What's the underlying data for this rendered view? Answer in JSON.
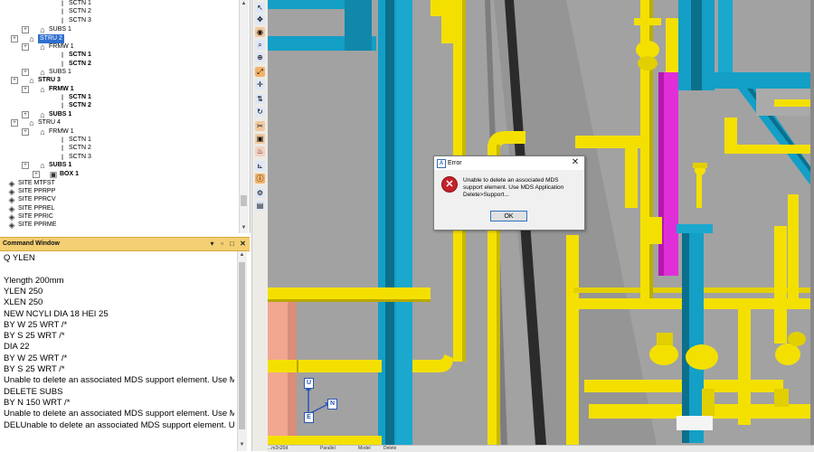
{
  "tree": {
    "rows": [
      {
        "label": "SCTN 1",
        "bold": false,
        "selected": false,
        "icon": "section-icon"
      },
      {
        "label": "SCTN 2",
        "bold": false,
        "selected": false,
        "icon": "section-icon"
      },
      {
        "label": "SCTN 3",
        "bold": false,
        "selected": false,
        "icon": "section-icon"
      },
      {
        "label": "SUBS 1",
        "bold": false,
        "selected": false,
        "icon": "subframe-icon"
      },
      {
        "label": "STRU 2",
        "bold": false,
        "selected": true,
        "icon": "structure-icon"
      },
      {
        "label": "FRMW 1",
        "bold": false,
        "selected": false,
        "icon": "framework-icon"
      },
      {
        "label": "SCTN 1",
        "bold": true,
        "selected": false,
        "icon": "section-icon"
      },
      {
        "label": "SCTN 2",
        "bold": true,
        "selected": false,
        "icon": "section-icon"
      },
      {
        "label": "SUBS 1",
        "bold": false,
        "selected": false,
        "icon": "subframe-icon"
      },
      {
        "label": "STRU 3",
        "bold": true,
        "selected": false,
        "icon": "structure-icon"
      },
      {
        "label": "FRMW 1",
        "bold": true,
        "selected": false,
        "icon": "framework-icon"
      },
      {
        "label": "SCTN 1",
        "bold": true,
        "selected": false,
        "icon": "section-icon"
      },
      {
        "label": "SCTN 2",
        "bold": true,
        "selected": false,
        "icon": "section-icon"
      },
      {
        "label": "SUBS 1",
        "bold": true,
        "selected": false,
        "icon": "subframe-icon"
      },
      {
        "label": "STRU 4",
        "bold": false,
        "selected": false,
        "icon": "structure-icon"
      },
      {
        "label": "FRMW 1",
        "bold": false,
        "selected": false,
        "icon": "framework-icon"
      },
      {
        "label": "SCTN 1",
        "bold": false,
        "selected": false,
        "icon": "section-icon"
      },
      {
        "label": "SCTN 2",
        "bold": false,
        "selected": false,
        "icon": "section-icon"
      },
      {
        "label": "SCTN 3",
        "bold": false,
        "selected": false,
        "icon": "section-icon"
      },
      {
        "label": "SUBS 1",
        "bold": true,
        "selected": false,
        "icon": "subframe-icon"
      },
      {
        "label": "BOX 1",
        "bold": true,
        "selected": false,
        "icon": "box-icon"
      },
      {
        "label": "SITE MTFST",
        "bold": false,
        "selected": false,
        "icon": "site-icon"
      },
      {
        "label": "SITE PPRPP",
        "bold": false,
        "selected": false,
        "icon": "site-icon"
      },
      {
        "label": "SITE PPRCV",
        "bold": false,
        "selected": false,
        "icon": "site-icon"
      },
      {
        "label": "SITE PPREL",
        "bold": false,
        "selected": false,
        "icon": "site-icon"
      },
      {
        "label": "SITE PPRIC",
        "bold": false,
        "selected": false,
        "icon": "site-icon"
      },
      {
        "label": "SITE PPRME",
        "bold": false,
        "selected": false,
        "icon": "site-icon"
      }
    ]
  },
  "command_window": {
    "title": "Command Window",
    "lines": [
      "Q YLEN",
      "",
      "Ylength 200mm",
      "YLEN 250",
      "XLEN 250",
      "NEW NCYLI DIA 18 HEI 25",
      "BY W 25 WRT /*",
      "BY S 25 WRT /*",
      "DIA 22",
      "BY W 25 WRT /*",
      "BY S 25 WRT /*",
      "Unable to delete an associated MDS support element. Use MI",
      "DELETE SUBS",
      "BY N 150 WRT /*",
      "Unable to delete an associated MDS support element. Use MI",
      "DELUnable to delete an associated MDS support element. Us"
    ]
  },
  "toolbar": {
    "icons": [
      "select-icon",
      "pan-icon",
      "orbit-icon",
      "zoom-window-icon",
      "zoom-icon",
      "walk-icon",
      "move-icon",
      "scale-icon",
      "rotate-icon",
      "clip-icon",
      "capture-icon",
      "fire-icon",
      "measure-icon",
      "info-icon",
      "settings-icon",
      "view-icon"
    ]
  },
  "dialog": {
    "title": "Error",
    "message": "Unable to delete an associated MDS support element. Use MDS Application Delete>Support...",
    "ok_label": "OK",
    "close_glyph": "✕"
  },
  "axes": {
    "up": "U",
    "north": "N",
    "east": "E"
  },
  "viewport_tabs": [
    "Parallel",
    "Model",
    "Delete"
  ],
  "viewport_tab_prefix": "...m2n20d",
  "colors": {
    "pipe": "#f4e000",
    "steel_blue": "#139fc6",
    "magenta": "#e02fd9",
    "floor": "#9d9d9d",
    "command_title": "#f4cf73",
    "selection": "#2f6fd0"
  }
}
